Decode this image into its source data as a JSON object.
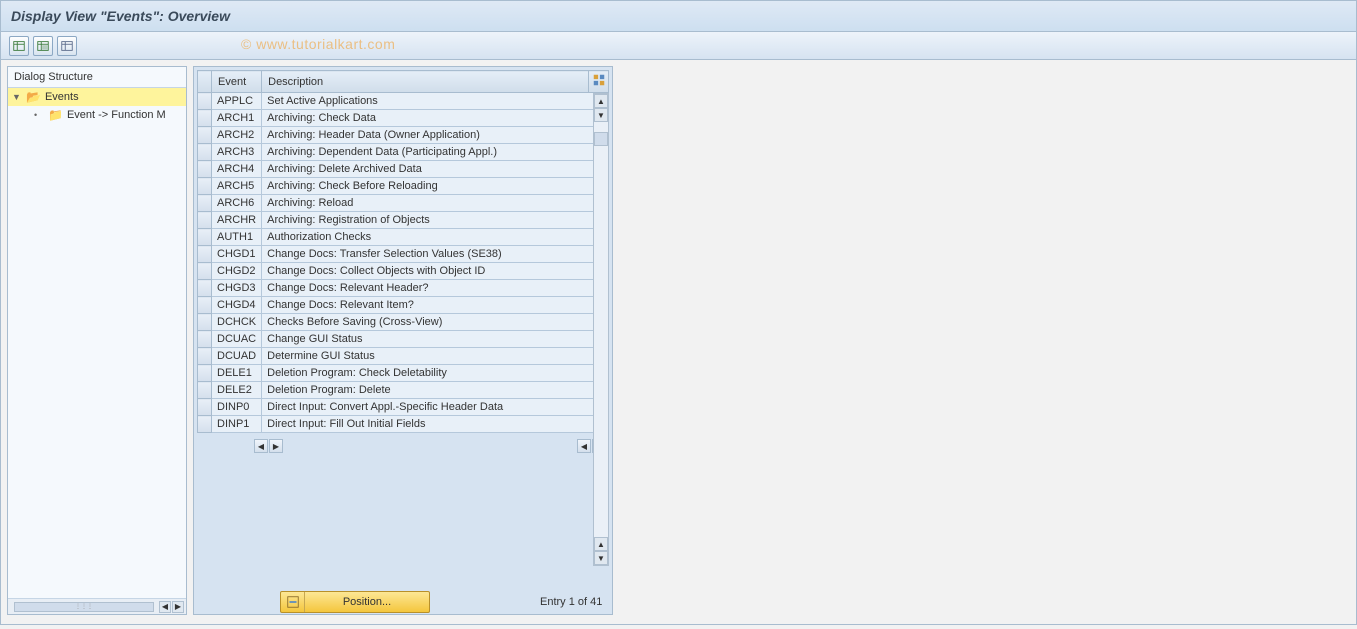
{
  "title": "Display View \"Events\": Overview",
  "watermark": "© www.tutorialkart.com",
  "dialog_structure": {
    "header": "Dialog Structure",
    "root": {
      "label": "Events",
      "expanded": true
    },
    "child": {
      "label": "Event -> Function M"
    }
  },
  "table": {
    "columns": {
      "event": "Event",
      "description": "Description"
    },
    "rows": [
      {
        "event": "APPLC",
        "description": "Set Active Applications"
      },
      {
        "event": "ARCH1",
        "description": "Archiving: Check Data"
      },
      {
        "event": "ARCH2",
        "description": "Archiving: Header Data (Owner Application)"
      },
      {
        "event": "ARCH3",
        "description": "Archiving: Dependent Data (Participating Appl.)"
      },
      {
        "event": "ARCH4",
        "description": "Archiving: Delete Archived Data"
      },
      {
        "event": "ARCH5",
        "description": "Archiving: Check Before Reloading"
      },
      {
        "event": "ARCH6",
        "description": "Archiving: Reload"
      },
      {
        "event": "ARCHR",
        "description": "Archiving: Registration of Objects"
      },
      {
        "event": "AUTH1",
        "description": "Authorization Checks"
      },
      {
        "event": "CHGD1",
        "description": "Change Docs: Transfer Selection Values (SE38)"
      },
      {
        "event": "CHGD2",
        "description": "Change Docs: Collect Objects with Object ID"
      },
      {
        "event": "CHGD3",
        "description": "Change Docs: Relevant Header?"
      },
      {
        "event": "CHGD4",
        "description": "Change Docs: Relevant Item?"
      },
      {
        "event": "DCHCK",
        "description": "Checks Before Saving (Cross-View)"
      },
      {
        "event": "DCUAC",
        "description": "Change GUI Status"
      },
      {
        "event": "DCUAD",
        "description": "Determine GUI Status"
      },
      {
        "event": "DELE1",
        "description": "Deletion Program: Check Deletability"
      },
      {
        "event": "DELE2",
        "description": "Deletion Program: Delete"
      },
      {
        "event": "DINP0",
        "description": "Direct Input: Convert Appl.-Specific Header Data"
      },
      {
        "event": "DINP1",
        "description": "Direct Input: Fill Out Initial Fields"
      }
    ]
  },
  "footer": {
    "position_label": "Position...",
    "entry_info": "Entry 1 of 41"
  }
}
